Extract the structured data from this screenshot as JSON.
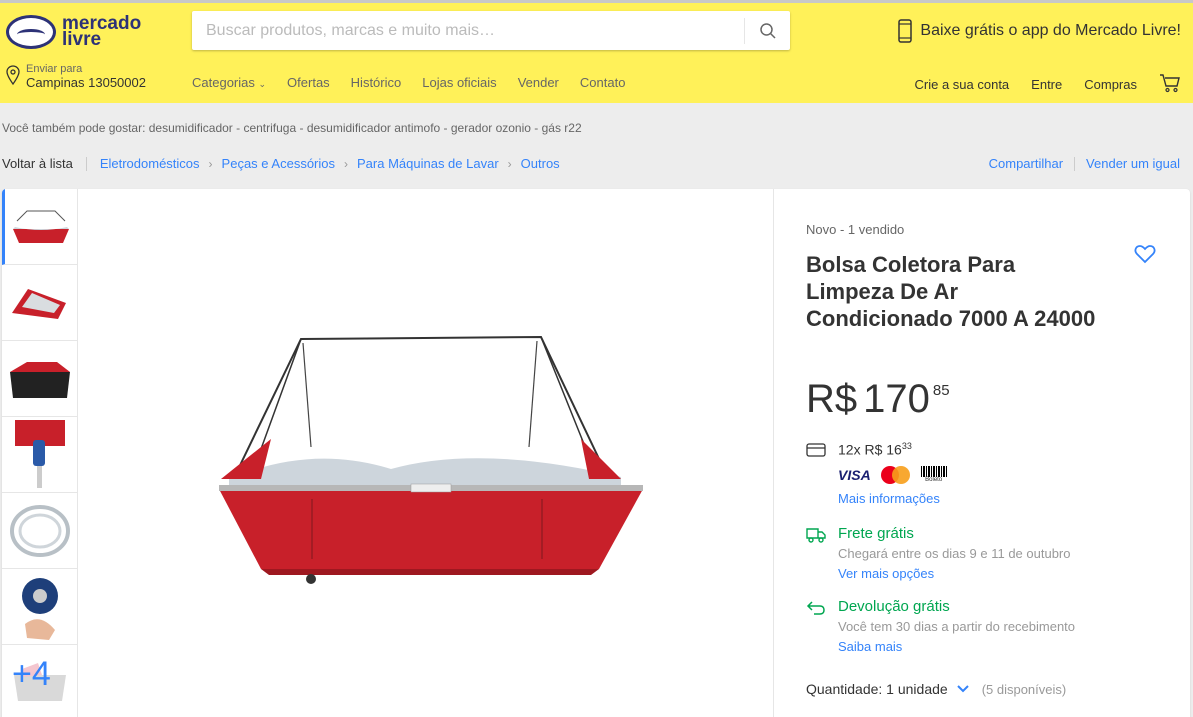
{
  "brand": {
    "line1": "mercado",
    "line2": "livre"
  },
  "search": {
    "placeholder": "Buscar produtos, marcas e muito mais…"
  },
  "promo": {
    "text": "Baixe grátis o app do Mercado Livre!"
  },
  "location": {
    "label": "Enviar para",
    "value": "Campinas 13050002"
  },
  "nav": {
    "items": [
      "Categorias",
      "Ofertas",
      "Histórico",
      "Lojas oficiais",
      "Vender",
      "Contato"
    ]
  },
  "account": {
    "items": [
      "Crie a sua conta",
      "Entre",
      "Compras"
    ]
  },
  "suggestions": {
    "text": "Você também pode gostar: desumidificador - centrifuga - desumidificador antimofo - gerador ozonio - gás r22"
  },
  "breadcrumbs": {
    "back": "Voltar à lista",
    "items": [
      "Eletrodomésticos",
      "Peças e Acessórios",
      "Para Máquinas de Lavar",
      "Outros"
    ]
  },
  "actions": {
    "share": "Compartilhar",
    "sell": "Vender um igual"
  },
  "gallery": {
    "more_count": "+4"
  },
  "product": {
    "condition": "Novo  -  1 vendido",
    "title": "Bolsa Coletora Para Limpeza De Ar Condicionado 7000 A 24000",
    "price_currency": "R$",
    "price_int": "170",
    "price_cents": "85",
    "installments": "12x R$ 16",
    "installments_cents": "33",
    "payment": {
      "visa": "VISA",
      "mastercard": "mastercard",
      "boleto": "Boleto"
    },
    "more_info": "Mais informações",
    "shipping_title": "Frete grátis",
    "shipping_sub": "Chegará entre os dias 9 e 11 de outubro",
    "shipping_link": "Ver mais opções",
    "return_title": "Devolução grátis",
    "return_sub": "Você tem 30 dias a partir do recebimento",
    "return_link": "Saiba mais",
    "quantity_label": "Quantidade: 1 unidade",
    "quantity_available": "(5 disponíveis)"
  },
  "colors": {
    "header": "#fff159",
    "accent": "#3483fa",
    "green": "#00a650",
    "product_red": "#c8202a"
  }
}
